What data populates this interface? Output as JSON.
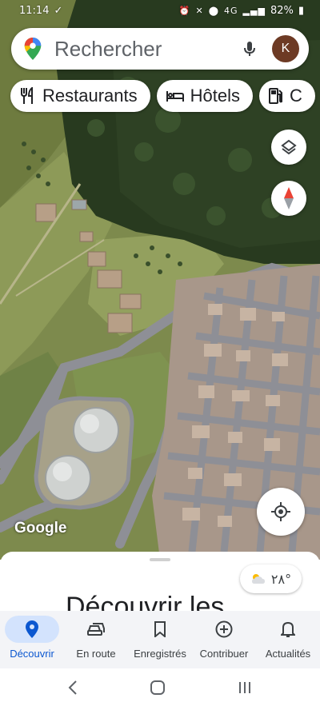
{
  "status_bar": {
    "time": "11:14",
    "network": "4G",
    "battery": "82%"
  },
  "search": {
    "placeholder": "Rechercher",
    "avatar_letter": "K"
  },
  "chips": [
    {
      "label": "Restaurants",
      "icon": "fork-knife-icon"
    },
    {
      "label": "Hôtels",
      "icon": "bed-icon"
    },
    {
      "label": "C",
      "icon": "gas-station-icon"
    }
  ],
  "map": {
    "attribution": "Google"
  },
  "weather": {
    "temperature": "٢٨°"
  },
  "sheet": {
    "title": "Découvrir les"
  },
  "bottom_nav": [
    {
      "label": "Découvrir",
      "icon": "location-pin-icon",
      "active": true
    },
    {
      "label": "En route",
      "icon": "car-icon",
      "active": false
    },
    {
      "label": "Enregistrés",
      "icon": "bookmark-icon",
      "active": false
    },
    {
      "label": "Contribuer",
      "icon": "add-circle-icon",
      "active": false
    },
    {
      "label": "Actualités",
      "icon": "bell-icon",
      "active": false
    }
  ],
  "colors": {
    "accent": "#0b57d0",
    "active_pill": "#d3e3fd",
    "avatar": "#6d3a24"
  }
}
